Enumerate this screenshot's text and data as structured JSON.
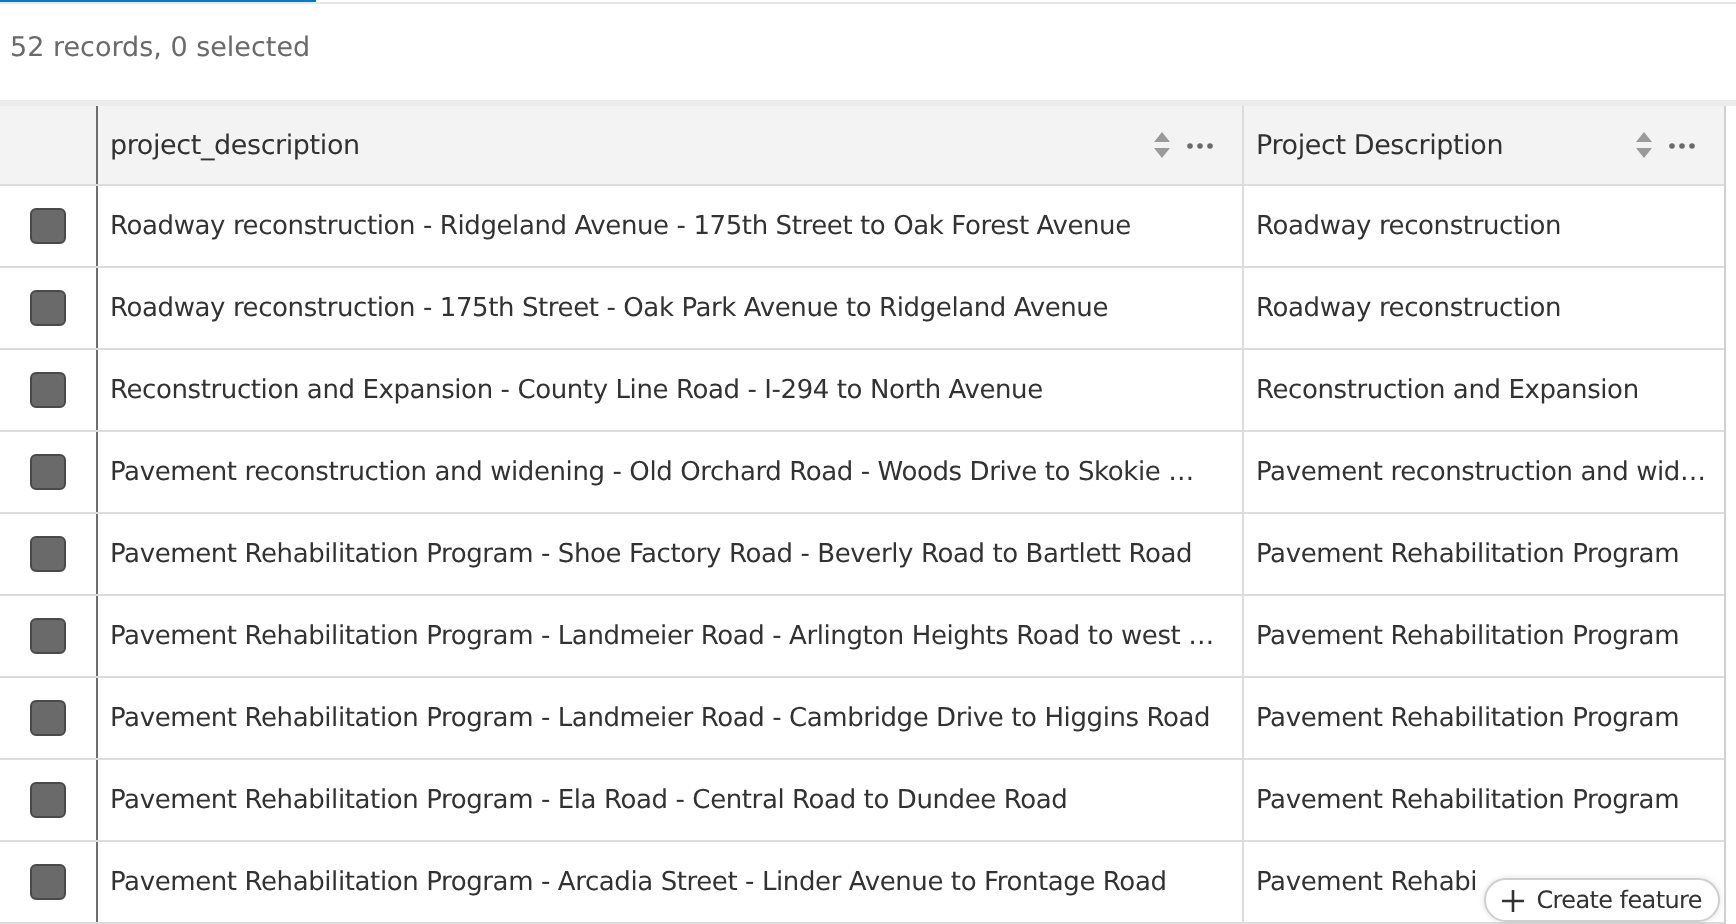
{
  "status": "52 records, 0 selected",
  "columns": [
    {
      "label": "project_description"
    },
    {
      "label": "Project Description"
    }
  ],
  "rows": [
    {
      "selected": false,
      "cells": [
        "Roadway reconstruction - Ridgeland Avenue - 175th Street to Oak Forest Avenue",
        "Roadway reconstruction"
      ]
    },
    {
      "selected": false,
      "cells": [
        "Roadway reconstruction - 175th Street - Oak Park Avenue to Ridgeland Avenue",
        "Roadway reconstruction"
      ]
    },
    {
      "selected": false,
      "cells": [
        "Reconstruction and Expansion - County Line Road - I-294 to North Avenue",
        "Reconstruction and Expansion"
      ]
    },
    {
      "selected": false,
      "cells": [
        "Pavement reconstruction and widening - Old Orchard Road - Woods Drive to Skokie …",
        "Pavement reconstruction and wid…"
      ]
    },
    {
      "selected": false,
      "cells": [
        "Pavement Rehabilitation Program - Shoe Factory Road - Beverly Road to Bartlett Road",
        "Pavement Rehabilitation Program"
      ]
    },
    {
      "selected": false,
      "cells": [
        "Pavement Rehabilitation Program - Landmeier Road - Arlington Heights Road to west …",
        "Pavement Rehabilitation Program"
      ]
    },
    {
      "selected": false,
      "cells": [
        "Pavement Rehabilitation Program - Landmeier Road - Cambridge Drive to Higgins Road",
        "Pavement Rehabilitation Program"
      ]
    },
    {
      "selected": false,
      "cells": [
        "Pavement Rehabilitation Program - Ela Road - Central Road to Dundee Road",
        "Pavement Rehabilitation Program"
      ]
    },
    {
      "selected": false,
      "cells": [
        "Pavement Rehabilitation Program - Arcadia Street - Linder Avenue to Frontage Road",
        "Pavement Rehabi"
      ]
    }
  ],
  "create_button": "Create feature"
}
